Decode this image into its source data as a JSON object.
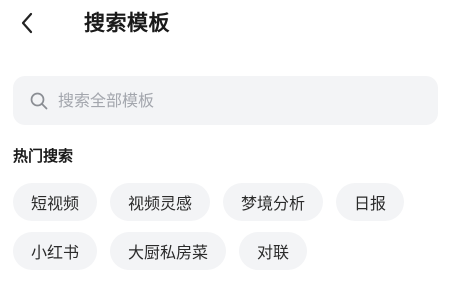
{
  "header": {
    "back_icon": "chevron-left-icon",
    "title": "搜索模板"
  },
  "search": {
    "icon": "search-icon",
    "placeholder": "搜索全部模板",
    "value": ""
  },
  "hot": {
    "title": "热门搜索",
    "row1": [
      "短视频",
      "视频灵感",
      "梦境分析",
      "日报"
    ],
    "row2": [
      "小红书",
      "大厨私房菜",
      "对联"
    ]
  },
  "colors": {
    "background": "#ffffff",
    "chip_bg": "#f3f4f6",
    "placeholder": "#a3a6ad",
    "text": "#1a1a1a"
  }
}
